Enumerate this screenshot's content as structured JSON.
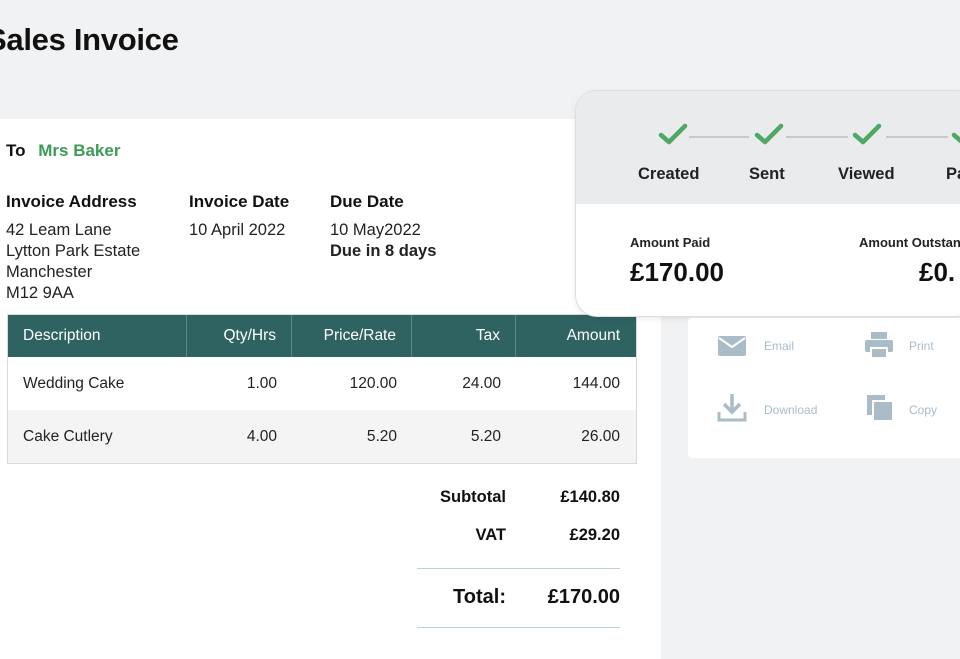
{
  "page": {
    "title": "Sales Invoice"
  },
  "recipient": {
    "to_label": "To",
    "name": "Mrs Baker"
  },
  "address": {
    "heading": "Invoice Address",
    "lines": [
      "42 Leam Lane",
      "Lytton Park Estate",
      "Manchester",
      "M12 9AA"
    ]
  },
  "invoice_date": {
    "heading": "Invoice Date",
    "value": "10 April 2022"
  },
  "due_date": {
    "heading": "Due Date",
    "value": "10 May2022",
    "note": "Due in 8 days"
  },
  "table": {
    "headers": [
      "Description",
      "Qty/Hrs",
      "Price/Rate",
      "Tax",
      "Amount"
    ],
    "rows": [
      [
        "Wedding Cake",
        "1.00",
        "120.00",
        "24.00",
        "144.00"
      ],
      [
        "Cake Cutlery",
        "4.00",
        "5.20",
        "5.20",
        "26.00"
      ]
    ]
  },
  "totals": {
    "subtotal_label": "Subtotal",
    "subtotal_value": "£140.80",
    "vat_label": "VAT",
    "vat_value": "£29.20",
    "total_label": "Total:",
    "total_value": "£170.00"
  },
  "status": {
    "steps": [
      "Created",
      "Sent",
      "Viewed",
      "Pa"
    ],
    "amount_paid_label": "Amount Paid",
    "amount_paid_value": "£170.00",
    "amount_outstanding_label": "Amount Outstan",
    "amount_outstanding_value": "£0."
  },
  "actions": {
    "email": "Email",
    "print": "Print",
    "download": "Download",
    "copy": "Copy"
  },
  "colors": {
    "brand_dark_green": "#2f6361",
    "accent_green": "#3d9a57",
    "check_green": "#4fa862",
    "muted_blue_gray": "#a9bcc8"
  },
  "icons": {
    "step": "check-icon",
    "email": "mail-icon",
    "print": "printer-icon",
    "download": "download-icon",
    "copy": "copy-icon"
  }
}
